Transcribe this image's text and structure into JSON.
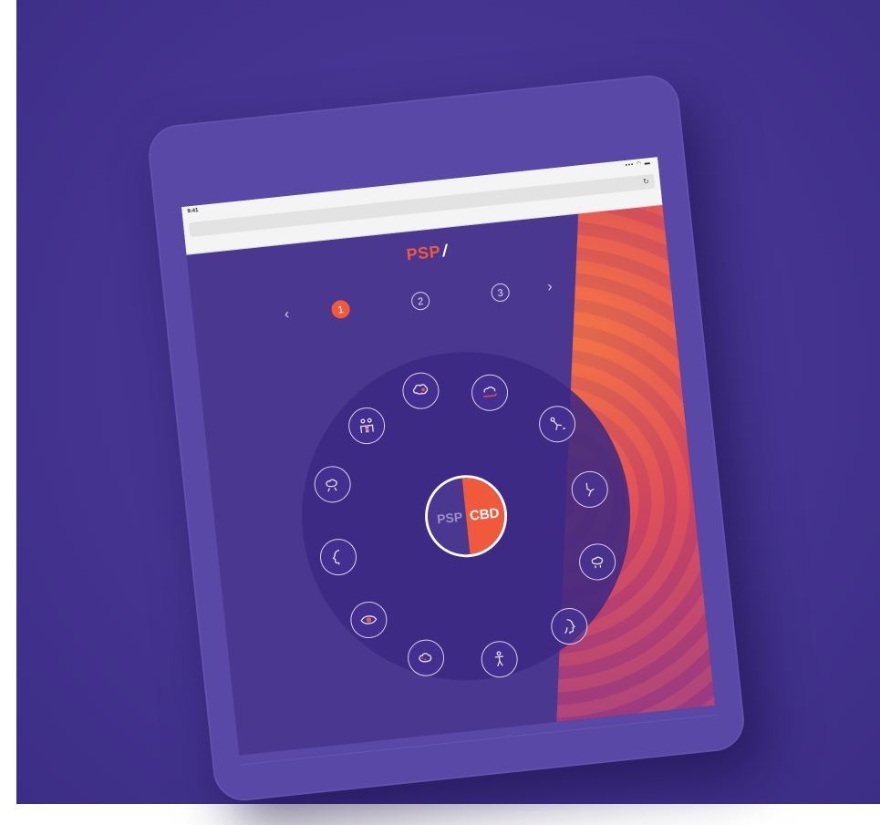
{
  "status_bar": {
    "time": "9:41",
    "icons": "▪▪▪ ◠ ▬"
  },
  "browser": {
    "reload_glyph": "↻"
  },
  "header": {
    "logo_text": "PSP",
    "logo_mark": "/"
  },
  "steps": {
    "prev_glyph": "‹",
    "next_glyph": "›",
    "items": [
      "1",
      "2",
      "3"
    ],
    "active": "1"
  },
  "center": {
    "left_label": "PSP",
    "right_label": "CBD"
  },
  "colors": {
    "background": "#453591",
    "tablet": "#5a48a7",
    "screen": "#4a3890",
    "accent": "#f05a3a",
    "line": "#d9d2f2"
  },
  "wheel_icons": [
    "brain-speech-icon",
    "brain-hand-icon",
    "falling-person-icon",
    "leg-movement-icon",
    "brain-body-icon",
    "face-profile-icon",
    "person-posture-icon",
    "brain-dots-icon",
    "eye-icon",
    "face-profile-icon",
    "brain-walk-icon",
    "caregivers-icon"
  ]
}
